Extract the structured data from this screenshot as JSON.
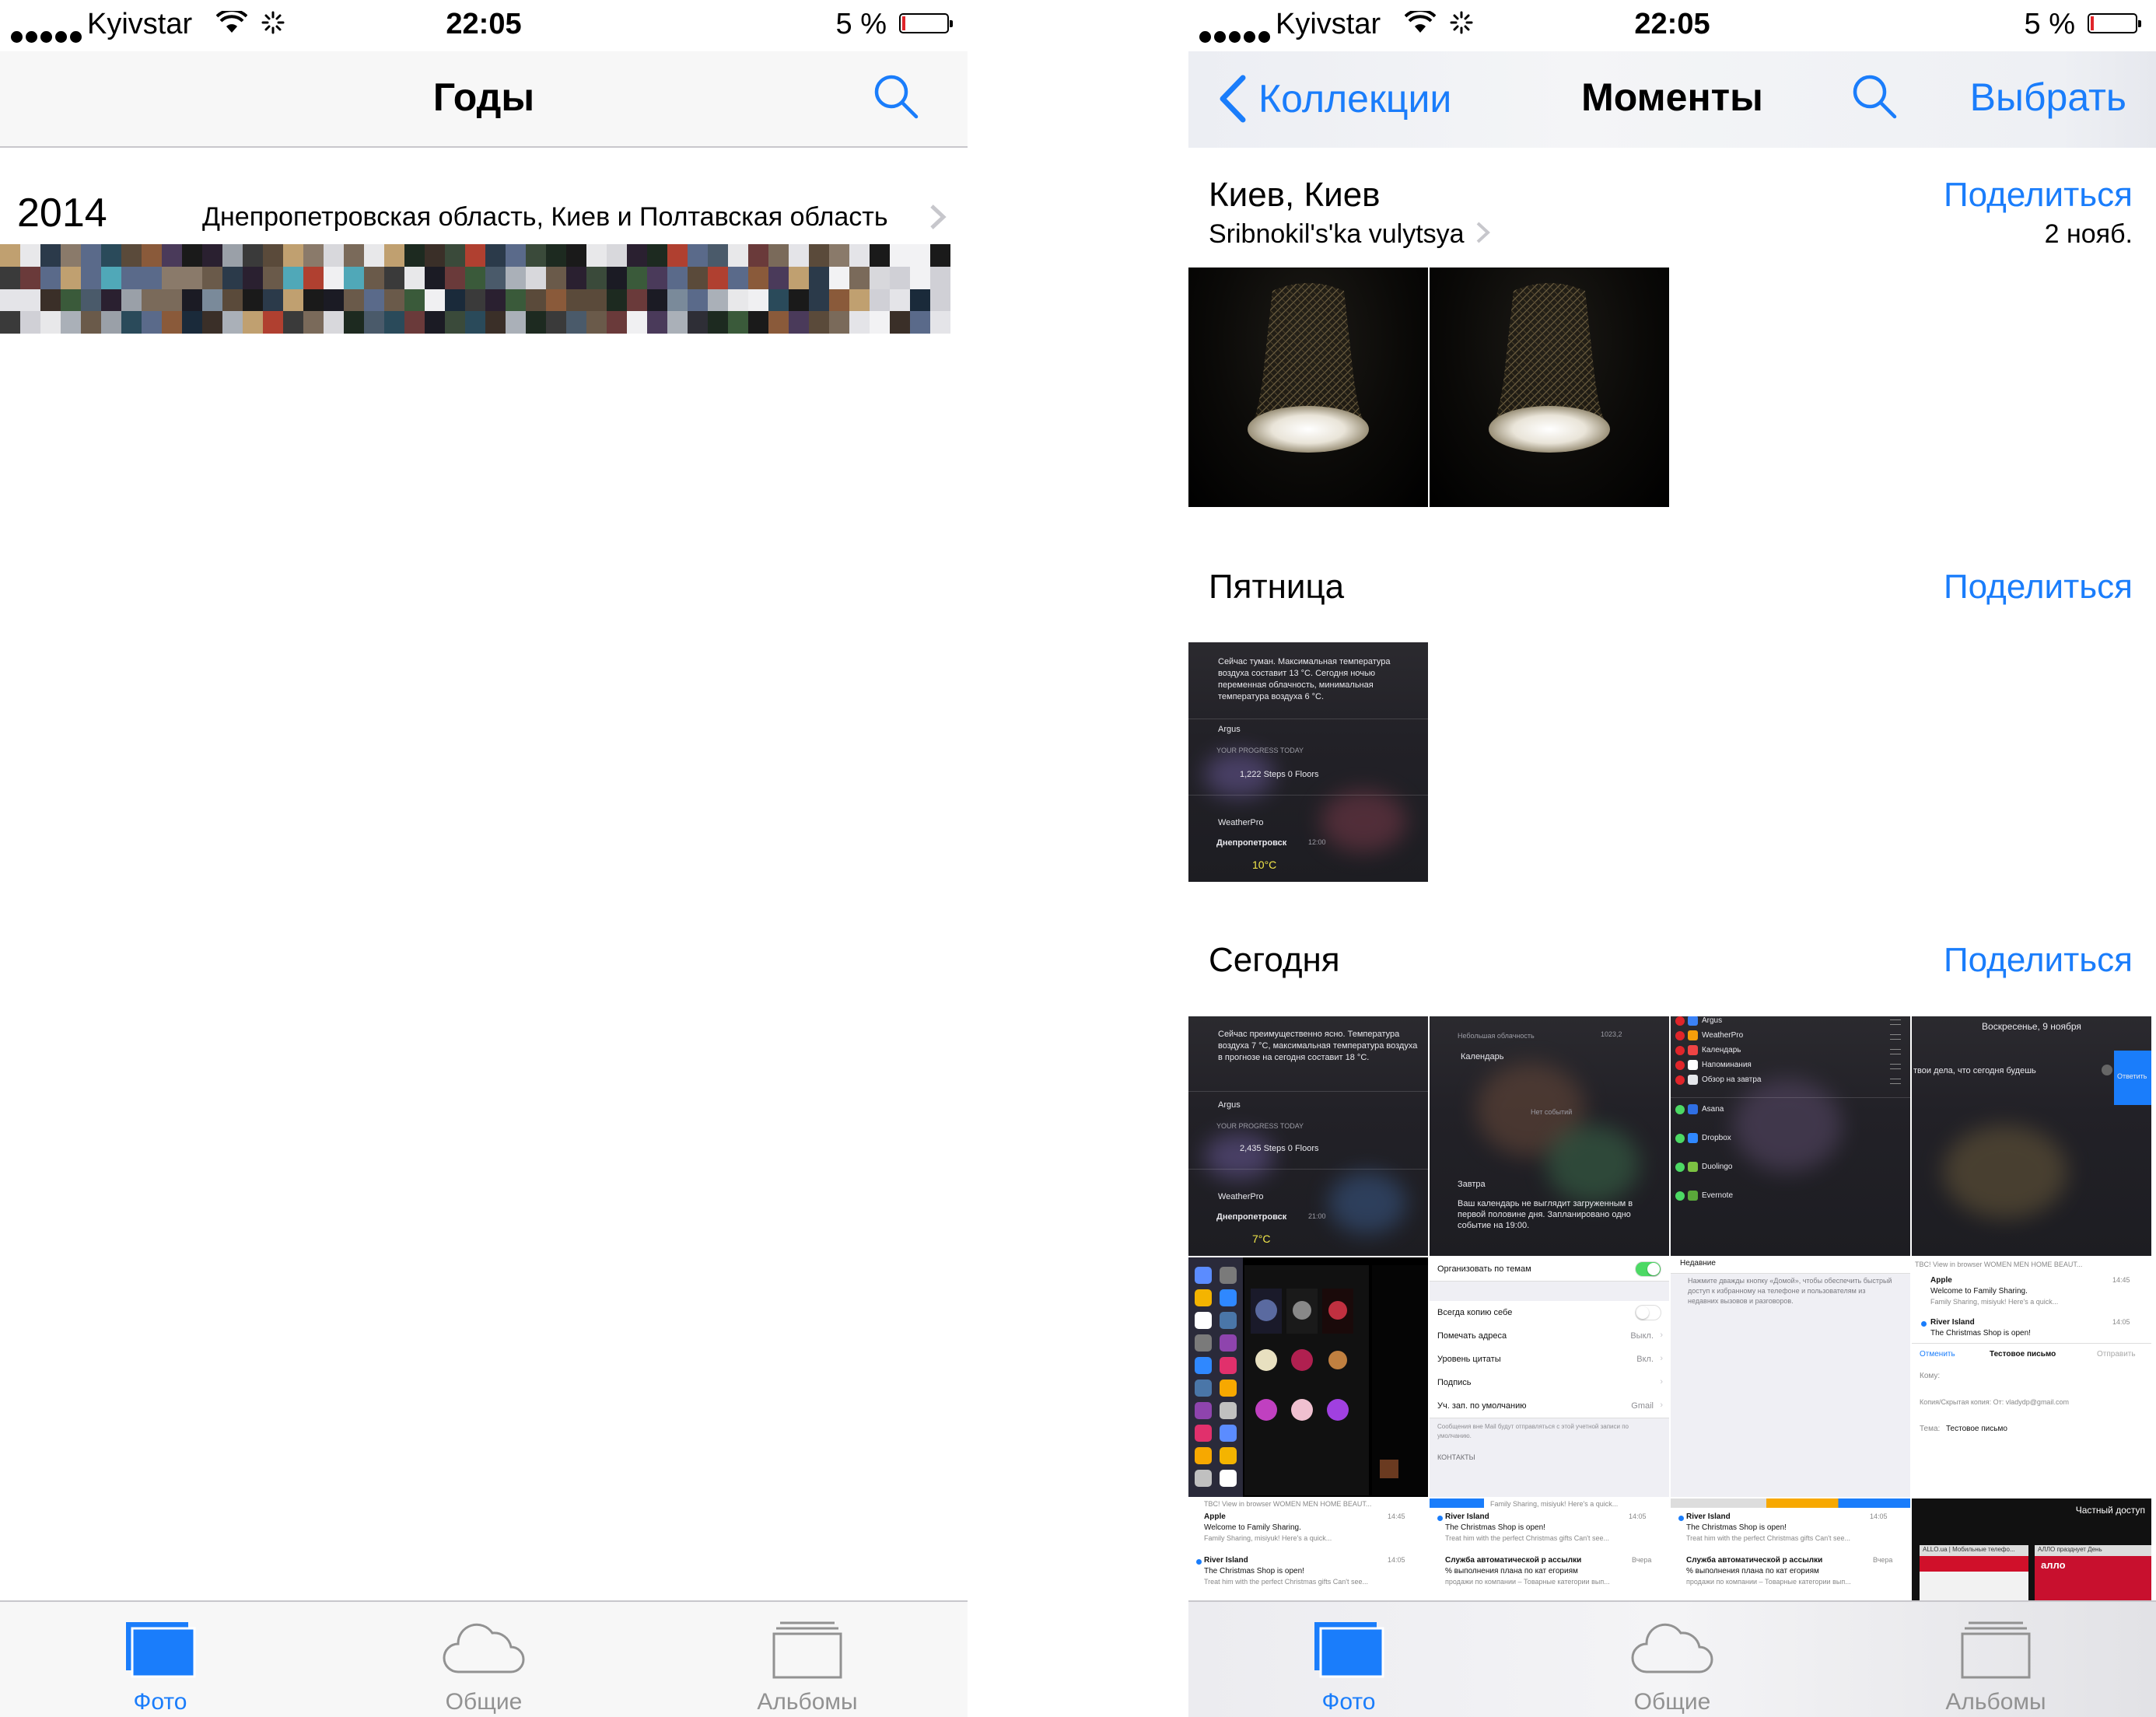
{
  "status_bar": {
    "carrier": "Kyivstar",
    "time": "22:05",
    "battery_percent": "5 %",
    "battery_level": 0.05
  },
  "left_screen": {
    "nav": {
      "title": "Годы",
      "search_icon": "search-icon"
    },
    "years": [
      {
        "year": "2014",
        "places": "Днепропетровская область, Киев и Полтавская область"
      }
    ]
  },
  "right_screen": {
    "nav": {
      "back_label": "Коллекции",
      "title": "Моменты",
      "select_label": "Выбрать",
      "search_icon": "search-icon"
    },
    "moments": [
      {
        "title": "Киев, Киев",
        "subtitle": "Sribnokil's'ka vulytsya",
        "date": "2 нояб.",
        "share_label": "Поделиться"
      },
      {
        "title": "Пятница",
        "share_label": "Поделиться"
      },
      {
        "title": "Сегодня",
        "share_label": "Поделиться"
      }
    ],
    "thumbnails": {
      "friday_widget": {
        "weather_text": "Сейчас туман. Максимальная температура воздуха составит 13 °C. Сегодня ночью переменная облачность, минимальная температура воздуха 6 °C.",
        "app1": "Argus",
        "progress_label": "YOUR PROGRESS TODAY",
        "steps": "1,222 Steps  0 Floors",
        "app2": "WeatherPro",
        "city": "Днепропетровск",
        "city_time": "12:00",
        "temp": "10°C"
      },
      "today_widget": {
        "weather_text": "Сейчас преимущественно ясно. Температура воздуха 7 °C, максимальная температура воздуха в прогнозе на сегодня составит 18 °C.",
        "app1": "Argus",
        "progress_label": "YOUR PROGRESS TODAY",
        "steps": "2,435 Steps  0 Floors",
        "app2": "WeatherPro",
        "city": "Днепропетровск",
        "city_time": "21:00",
        "temp": "7°C"
      },
      "calendar_widget": {
        "cloud": "Небольшая облачность",
        "pressure": "1023,2",
        "calendar": "Календарь",
        "no_events": "Нет событий",
        "tomorrow": "Завтра",
        "note": "Ваш календарь не выглядит загруженным в первой половине дня. Запланировано одно событие на 19:00."
      },
      "edit_widgets": {
        "items": [
          "Argus",
          "WeatherPro",
          "Календарь",
          "Напоминания",
          "Обзор на завтра"
        ],
        "add_items": [
          "Asana",
          "Dropbox",
          "Duolingo",
          "Evernote"
        ]
      },
      "notification": {
        "date": "Воскресенье, 9 ноября",
        "text": "твои дела, что сегодня будешь",
        "reply": "Ответить"
      },
      "mail_settings": {
        "rows": [
          {
            "label": "Организовать по темам",
            "value": ""
          },
          {
            "label": "Всегда копию себе",
            "value": ""
          },
          {
            "label": "Помечать адреса",
            "value": "Выкл."
          },
          {
            "label": "Уровень цитаты",
            "value": "Вкл."
          },
          {
            "label": "Подпись",
            "value": ""
          },
          {
            "label": "Уч. зап. по умолчанию",
            "value": "Gmail"
          }
        ],
        "footer": "Сообщения вне Mail будут отправляться с этой учетной записи по умолчанию.",
        "section": "КОНТАКТЫ"
      },
      "recents_text": "Нажмите дважды кнопку «Домой», чтобы обеспечить быстрый доступ к избранному на телефоне и пользователям из недавних вызовов и разговоров.",
      "recents_label": "Недавние",
      "compose": {
        "cancel": "Отменить",
        "title": "Тестовое письмо",
        "send": "Отправить",
        "to": "Кому:",
        "cc": "Копия/Скрытая копия: От: vladydp@gmail.com",
        "subject_label": "Тема:",
        "subject": "Тестовое письмо"
      },
      "mail_preview_header": "TBC! View in browser WOMEN MEN HOME BEAUT...",
      "mail_items": [
        {
          "from": "Apple",
          "time": "14:45",
          "subject": "Welcome to Family Sharing.",
          "preview": "Family Sharing, misiyuk! Here's a quick..."
        },
        {
          "from": "River Island",
          "time": "14:05",
          "subject": "The Christmas Shop is open!",
          "preview": "Treat him with the perfect Christmas gifts Can't see..."
        },
        {
          "from": "Служба автоматической р ассылки",
          "time": "Вчера",
          "subject": "% выполнения плана по кат егориям",
          "preview": "продажи по компании – Товарные категории вып..."
        }
      ],
      "private_access": "Частный доступ",
      "allo_text": "ALLO.ua | Мобильные телефо...",
      "allo_promo": "АЛЛО празднует День",
      "allo_logo": "алло"
    }
  },
  "tab_bar": {
    "tabs": [
      {
        "label": "Фото",
        "icon": "photos-icon",
        "active": true
      },
      {
        "label": "Общие",
        "icon": "cloud-icon",
        "active": false
      },
      {
        "label": "Альбомы",
        "icon": "albums-icon",
        "active": false
      }
    ]
  },
  "colors": {
    "accent": "#1a7dfb",
    "battery_low": "#e0252a",
    "toggle_on": "#4cd964"
  }
}
